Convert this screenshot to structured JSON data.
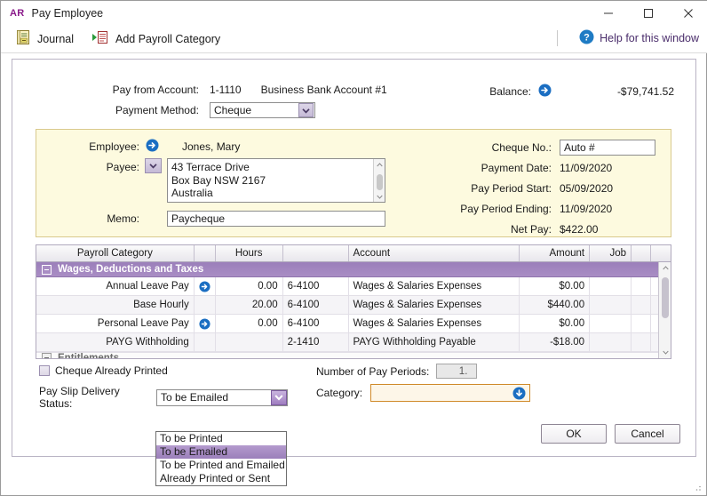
{
  "window": {
    "badge": "AR",
    "title": "Pay Employee",
    "minimize": "minimize-button",
    "maximize": "maximize-button",
    "close": "close-button"
  },
  "toolbar": {
    "journal_label": "Journal",
    "add_payroll_category_label": "Add Payroll Category",
    "help_label": "Help for this window"
  },
  "form": {
    "pay_from_account_label": "Pay from Account:",
    "pay_from_account_number": "1-1110",
    "pay_from_account_name": "Business Bank Account #1",
    "payment_method_label": "Payment Method:",
    "payment_method_value": "Cheque",
    "balance_label": "Balance:",
    "balance_value": "-$79,741.52"
  },
  "employee_card": {
    "employee_label": "Employee:",
    "employee_value": "Jones, Mary",
    "payee_label": "Payee:",
    "payee_address": [
      "43 Terrace Drive",
      "Box Bay  NSW  2167",
      "Australia"
    ],
    "memo_label": "Memo:",
    "memo_value": "Paycheque",
    "cheque_no_label": "Cheque No.:",
    "cheque_no_value": "Auto #",
    "payment_date_label": "Payment Date:",
    "payment_date_value": "11/09/2020",
    "pay_period_start_label": "Pay Period Start:",
    "pay_period_start_value": "05/09/2020",
    "pay_period_ending_label": "Pay Period Ending:",
    "pay_period_ending_value": "11/09/2020",
    "net_pay_label": "Net Pay:",
    "net_pay_value": "$422.00"
  },
  "grid": {
    "headers": [
      "Payroll Category",
      "",
      "Hours",
      "",
      "Account",
      "Amount",
      "Job",
      "",
      ""
    ],
    "group_row": "Wages, Deductions and Taxes",
    "group_row_2": "Entitlements",
    "rows": [
      {
        "category": "Annual Leave Pay",
        "has_arrow": true,
        "hours": "0.00",
        "account_no": "6-4100",
        "account_name": "Wages & Salaries Expenses",
        "amount": "$0.00",
        "job": ""
      },
      {
        "category": "Base Hourly",
        "has_arrow": false,
        "hours": "20.00",
        "account_no": "6-4100",
        "account_name": "Wages & Salaries Expenses",
        "amount": "$440.00",
        "job": ""
      },
      {
        "category": "Personal Leave Pay",
        "has_arrow": true,
        "hours": "0.00",
        "account_no": "6-4100",
        "account_name": "Wages & Salaries Expenses",
        "amount": "$0.00",
        "job": ""
      },
      {
        "category": "PAYG Withholding",
        "has_arrow": false,
        "hours": "",
        "account_no": "2-1410",
        "account_name": "PAYG Withholding Payable",
        "amount": "-$18.00",
        "job": ""
      }
    ]
  },
  "bottom": {
    "cheque_already_printed_label": "Cheque Already Printed",
    "cheque_already_printed_checked": false,
    "pay_slip_delivery_status_label": "Pay Slip Delivery Status:",
    "pay_slip_delivery_status_value": "To be Emailed",
    "pay_slip_delivery_options": [
      "To be Printed",
      "To be Emailed",
      "To be Printed and Emailed",
      "Already Printed or Sent"
    ],
    "pay_slip_delivery_selected_index": 1,
    "number_of_pay_periods_label": "Number of Pay Periods:",
    "number_of_pay_periods_value": "1.",
    "category_label": "Category:",
    "category_value": ""
  },
  "footer": {
    "ok_label": "OK",
    "cancel_label": "Cancel"
  },
  "colors": {
    "accent_purple": "#9b7fba",
    "card_yellow": "#fdfadf",
    "card_border": "#d9c98d",
    "link_blue": "#1b6ec2",
    "category_orange": "#d08a2a",
    "badge_magenta": "#8a1a8a"
  }
}
